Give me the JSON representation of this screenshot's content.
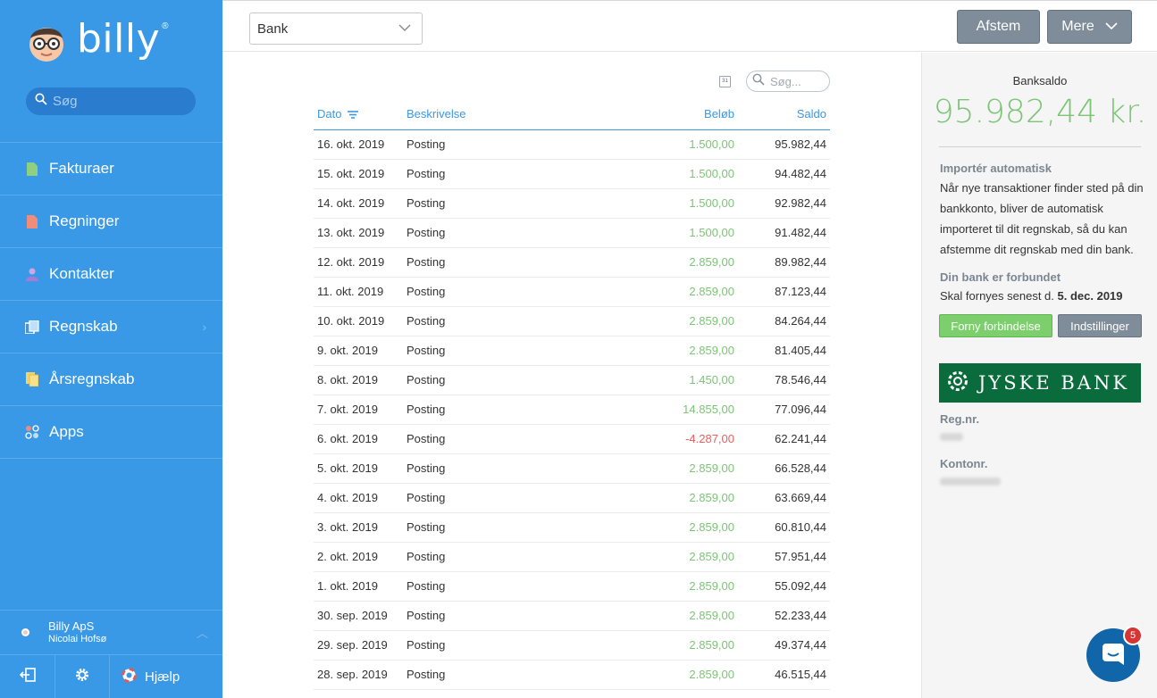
{
  "brand": {
    "name": "billy",
    "reg_mark": "®"
  },
  "sidebar": {
    "search_placeholder": "Søg",
    "items": [
      {
        "label": "Fakturaer",
        "icon": "invoice-icon",
        "color": "#8ed07f"
      },
      {
        "label": "Regninger",
        "icon": "bill-icon",
        "color": "#f08c7a"
      },
      {
        "label": "Kontakter",
        "icon": "contact-icon",
        "color": "#a67bd2"
      },
      {
        "label": "Regnskab",
        "icon": "accounting-icon",
        "color": "#e8eef5"
      },
      {
        "label": "Årsregnskab",
        "icon": "annual-report-icon",
        "color": "#f3d36a"
      },
      {
        "label": "Apps",
        "icon": "apps-icon",
        "color": "#f08c7a"
      }
    ],
    "account": {
      "company": "Billy ApS",
      "user": "Nicolai Hofsø"
    },
    "footer": {
      "help_label": "Hjælp"
    }
  },
  "topbar": {
    "account_select": "Bank",
    "afstem_label": "Afstem",
    "mere_label": "Mere"
  },
  "table": {
    "search_placeholder": "Søg...",
    "calendar_label": "31",
    "columns": {
      "date": "Dato",
      "description": "Beskrivelse",
      "amount": "Beløb",
      "balance": "Saldo"
    },
    "rows": [
      {
        "date": "16. okt. 2019",
        "description": "Posting",
        "amount": "1.500,00",
        "balance": "95.982,44",
        "negative": false
      },
      {
        "date": "15. okt. 2019",
        "description": "Posting",
        "amount": "1.500,00",
        "balance": "94.482,44",
        "negative": false
      },
      {
        "date": "14. okt. 2019",
        "description": "Posting",
        "amount": "1.500,00",
        "balance": "92.982,44",
        "negative": false
      },
      {
        "date": "13. okt. 2019",
        "description": "Posting",
        "amount": "1.500,00",
        "balance": "91.482,44",
        "negative": false
      },
      {
        "date": "12. okt. 2019",
        "description": "Posting",
        "amount": "2.859,00",
        "balance": "89.982,44",
        "negative": false
      },
      {
        "date": "11. okt. 2019",
        "description": "Posting",
        "amount": "2.859,00",
        "balance": "87.123,44",
        "negative": false
      },
      {
        "date": "10. okt. 2019",
        "description": "Posting",
        "amount": "2.859,00",
        "balance": "84.264,44",
        "negative": false
      },
      {
        "date": "9. okt. 2019",
        "description": "Posting",
        "amount": "2.859,00",
        "balance": "81.405,44",
        "negative": false
      },
      {
        "date": "8. okt. 2019",
        "description": "Posting",
        "amount": "1.450,00",
        "balance": "78.546,44",
        "negative": false
      },
      {
        "date": "7. okt. 2019",
        "description": "Posting",
        "amount": "14.855,00",
        "balance": "77.096,44",
        "negative": false
      },
      {
        "date": "6. okt. 2019",
        "description": "Posting",
        "amount": "-4.287,00",
        "balance": "62.241,44",
        "negative": true
      },
      {
        "date": "5. okt. 2019",
        "description": "Posting",
        "amount": "2.859,00",
        "balance": "66.528,44",
        "negative": false
      },
      {
        "date": "4. okt. 2019",
        "description": "Posting",
        "amount": "2.859,00",
        "balance": "63.669,44",
        "negative": false
      },
      {
        "date": "3. okt. 2019",
        "description": "Posting",
        "amount": "2.859,00",
        "balance": "60.810,44",
        "negative": false
      },
      {
        "date": "2. okt. 2019",
        "description": "Posting",
        "amount": "2.859,00",
        "balance": "57.951,44",
        "negative": false
      },
      {
        "date": "1. okt. 2019",
        "description": "Posting",
        "amount": "2.859,00",
        "balance": "55.092,44",
        "negative": false
      },
      {
        "date": "30. sep. 2019",
        "description": "Posting",
        "amount": "2.859,00",
        "balance": "52.233,44",
        "negative": false
      },
      {
        "date": "29. sep. 2019",
        "description": "Posting",
        "amount": "2.859,00",
        "balance": "49.374,44",
        "negative": false
      },
      {
        "date": "28. sep. 2019",
        "description": "Posting",
        "amount": "2.859,00",
        "balance": "46.515,44",
        "negative": false
      }
    ]
  },
  "panel": {
    "balance_label": "Banksaldo",
    "balance_value": "95.982,44 kr.",
    "import_heading": "Importér automatisk",
    "import_text": "Når nye transaktioner finder sted på din bankkonto, bliver de automatisk importeret til dit regnskab, så du kan afstemme dit regnskab med din bank.",
    "connected_heading": "Din bank er forbundet",
    "renew_prefix": "Skal fornyes senest d. ",
    "renew_date": "5. dec. 2019",
    "renew_button": "Forny forbindelse",
    "settings_button": "Indstillinger",
    "bank_name": "JYSKE BANK",
    "reg_label": "Reg.nr.",
    "account_label": "Kontonr."
  },
  "chat": {
    "badge_count": "5"
  },
  "colors": {
    "sidebar": "#3a99e6",
    "positive": "#7cc576",
    "negative": "#e96060",
    "bank": "#0a6b3d"
  }
}
